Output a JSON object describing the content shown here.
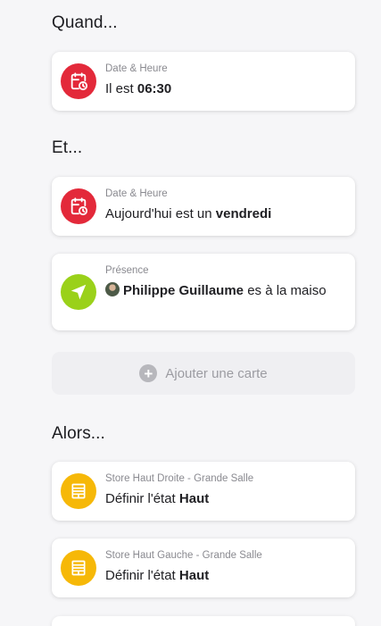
{
  "sections": {
    "when": "Quand...",
    "and": "Et...",
    "then": "Alors..."
  },
  "triggers": [
    {
      "icon": "calendar-clock-icon",
      "color": "#e3293a",
      "subtitle": "Date & Heure",
      "text_prefix": "Il est ",
      "text_bold": "06:30",
      "text_suffix": ""
    }
  ],
  "conditions": [
    {
      "icon": "calendar-clock-icon",
      "color": "#e3293a",
      "subtitle": "Date & Heure",
      "text_prefix": "Aujourd'hui est un ",
      "text_bold": "vendredi",
      "text_suffix": ""
    },
    {
      "icon": "navigation-arrow-icon",
      "color": "#9ad11a",
      "subtitle": "Présence",
      "text_prefix": "",
      "text_bold": "Philippe Guillaume",
      "text_suffix": " es à la maiso"
    }
  ],
  "add_card_label": "Ajouter une carte",
  "actions": [
    {
      "icon": "window-blind-icon",
      "color": "#f6b808",
      "subtitle": "Store Haut Droite - Grande Salle",
      "text_prefix": "Définir l'état ",
      "text_bold": "Haut",
      "text_suffix": ""
    },
    {
      "icon": "window-blind-icon",
      "color": "#f6b808",
      "subtitle": "Store Haut Gauche - Grande Salle",
      "text_prefix": "Définir l'état ",
      "text_bold": "Haut",
      "text_suffix": ""
    }
  ]
}
